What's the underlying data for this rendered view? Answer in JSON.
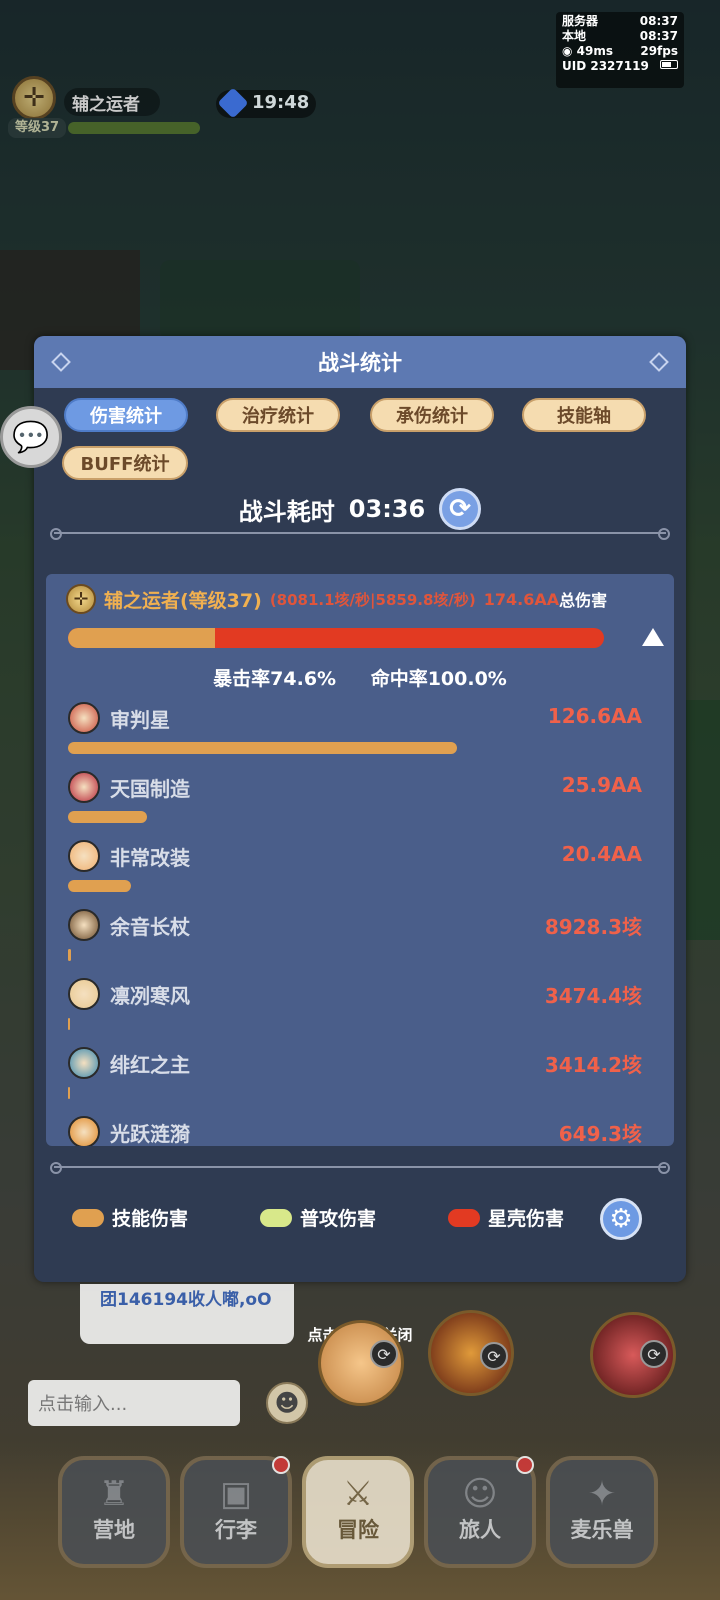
{
  "status": {
    "server_label": "服务器",
    "server_time": "08:37",
    "local_label": "本地",
    "local_time": "08:37",
    "ping": "49ms",
    "fps": "29fps",
    "uid": "UID  2327119"
  },
  "hud": {
    "player_name": "辅之运者",
    "level": "等级37",
    "timer": "19:48"
  },
  "modal": {
    "title": "战斗统计",
    "tabs": [
      "伤害统计",
      "治疗统计",
      "承伤统计",
      "技能轴",
      "BUFF统计"
    ],
    "active_tab": "伤害统计",
    "duration_label": "战斗耗时",
    "duration_value": "03:36",
    "player": {
      "name": "辅之运者(等级37)",
      "rates": "(8081.1垓/秒|5859.8垓/秒)",
      "total": "174.6AA",
      "total_label": "总伤害",
      "skill_fraction": 0.275,
      "crit": "暴击率74.6%",
      "hit": "命中率100.0%"
    },
    "skills": [
      {
        "name": "审判星",
        "value": "126.6AA",
        "fraction": 0.725,
        "color": "#c84a3a"
      },
      {
        "name": "天国制造",
        "value": "25.9AA",
        "fraction": 0.148,
        "color": "#b8283a"
      },
      {
        "name": "非常改装",
        "value": "20.4AA",
        "fraction": 0.117,
        "color": "#f0b070"
      },
      {
        "name": "余音长杖",
        "value": "8928.3垓",
        "fraction": 0.005,
        "color": "#6a4a2a"
      },
      {
        "name": "凛冽寒风",
        "value": "3474.4垓",
        "fraction": 0.003,
        "color": "#e8c890"
      },
      {
        "name": "绯红之主",
        "value": "3414.2垓",
        "fraction": 0.003,
        "color": "#3a8ab0"
      },
      {
        "name": "光跃涟漪",
        "value": "649.3垓",
        "fraction": 0.002,
        "color": "#e08a2a"
      }
    ],
    "legend": [
      {
        "label": "技能伤害",
        "color": "#e0a050"
      },
      {
        "label": "普攻伤害",
        "color": "#d8e88a"
      },
      {
        "label": "星壳伤害",
        "color": "#e23a22"
      }
    ]
  },
  "chat": {
    "message": "团146194收人嘟,oO",
    "close_hint": "点击空白处关闭",
    "input_placeholder": "点击输入..."
  },
  "nav": [
    {
      "label": "营地",
      "icon": "castle-icon"
    },
    {
      "label": "行李",
      "icon": "chest-icon"
    },
    {
      "label": "冒险",
      "icon": "crossed-swords-icon"
    },
    {
      "label": "旅人",
      "icon": "traveler-icon"
    },
    {
      "label": "麦乐兽",
      "icon": "fox-icon"
    }
  ]
}
